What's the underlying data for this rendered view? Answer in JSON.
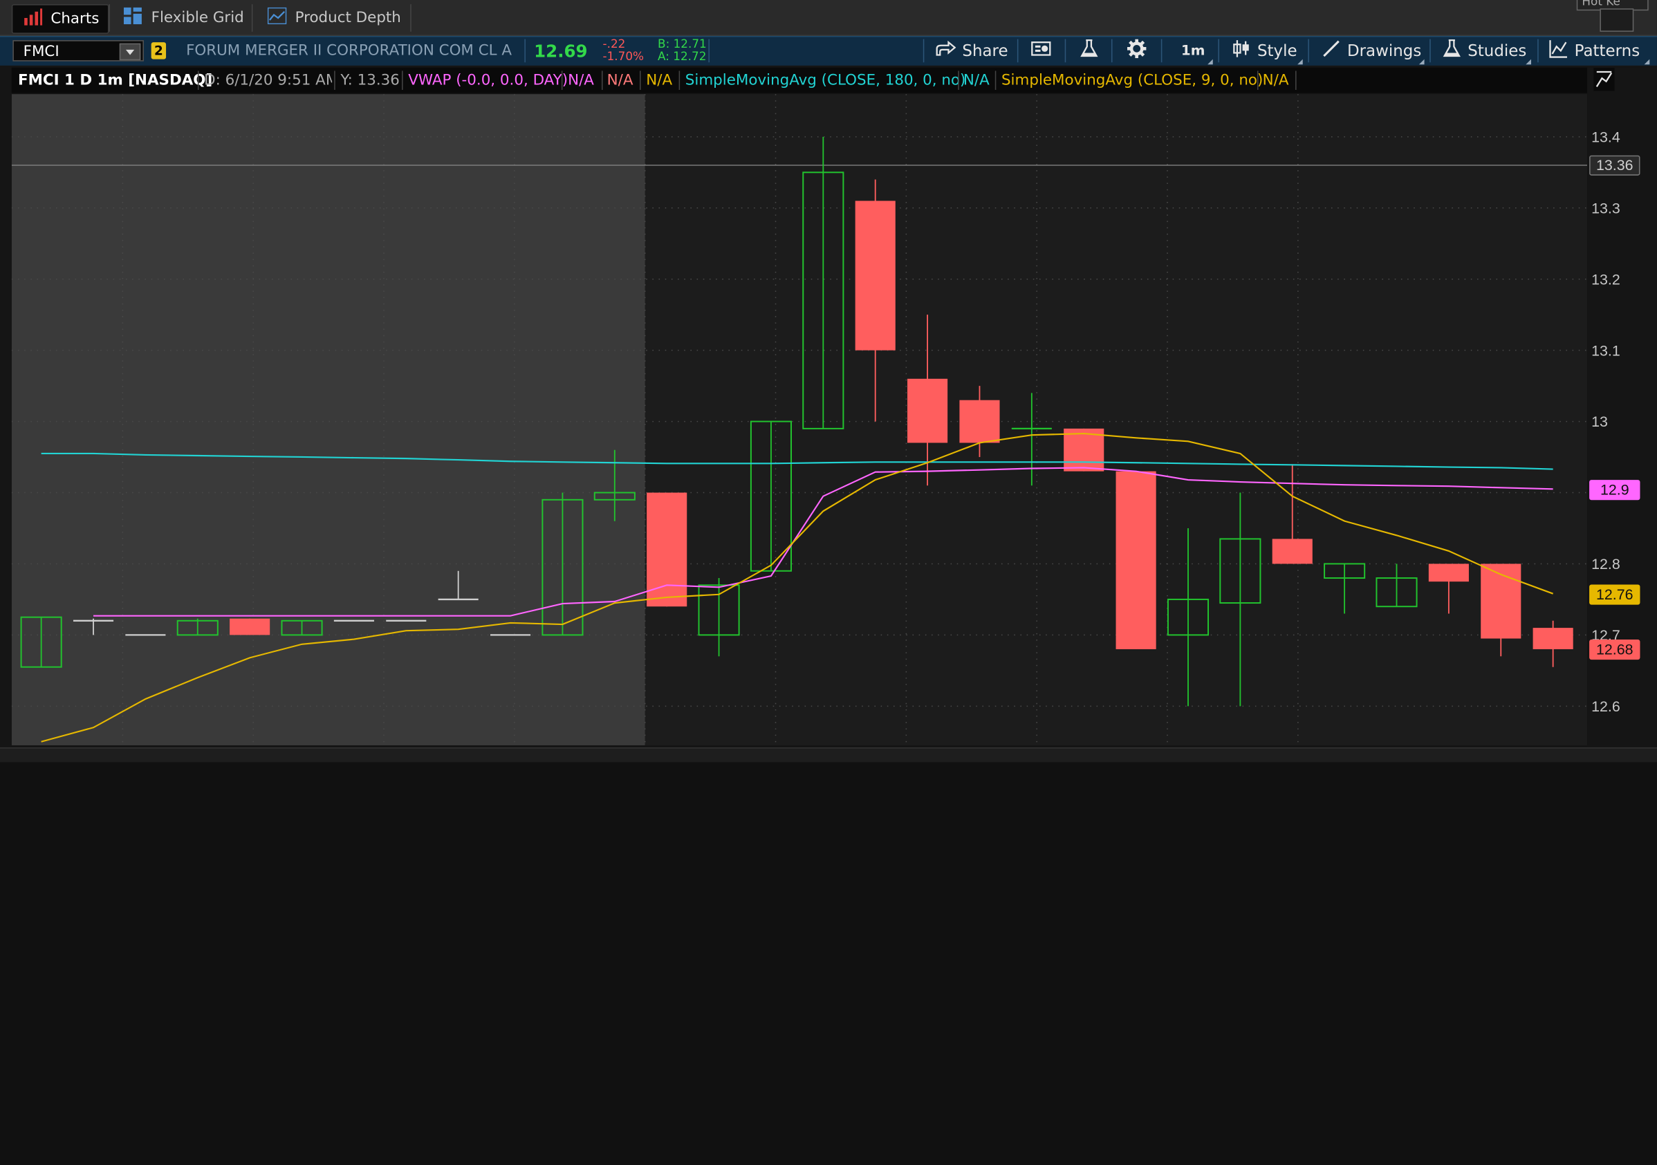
{
  "tabs": [
    {
      "label": "Charts",
      "active": true
    },
    {
      "label": "Flexible Grid",
      "active": false
    },
    {
      "label": "Product Depth",
      "active": false
    }
  ],
  "hotkeys_label": "Hot Ke",
  "toolbar": {
    "symbol": "FMCI",
    "link_badge": "2",
    "company": "FORUM MERGER II CORPORATION COM CL A",
    "last": "12.69",
    "change": "-.22",
    "change_pct": "-1.70%",
    "bid": "B: 12.71",
    "ask": "A: 12.72",
    "share": "Share",
    "timeframe": "1m",
    "style": "Style",
    "drawings": "Drawings",
    "studies": "Studies",
    "patterns": "Patterns"
  },
  "study_bar": {
    "title": "FMCI 1 D 1m [NASDAQ]",
    "date": "D: 6/1/20 9:51 AM",
    "y": "Y: 13.36",
    "vwap": "VWAP (-0.0, 0.0, DAY)",
    "vwap_vals": [
      "N/A",
      "N/A",
      "N/A"
    ],
    "sma180": "SimpleMovingAvg (CLOSE, 180, 0, no)",
    "sma180_val": "N/A",
    "sma9": "SimpleMovingAvg (CLOSE, 9, 0, no)",
    "sma9_val": "N/A"
  },
  "colors": {
    "up": "#22c32e",
    "down": "#ff5e5e",
    "vwap": "#ff66ff",
    "sma180": "#22d3d3",
    "sma9": "#e6b800",
    "premarket_bg": "#3a3a3a"
  },
  "chart_data": {
    "type": "candlestick",
    "ylim": [
      12.545,
      13.46
    ],
    "yticks": [
      "13.4",
      "13.3",
      "13.2",
      "13.1",
      "13",
      "12.9",
      "12.8",
      "12.7",
      "12.6"
    ],
    "crosshair_y": 13.36,
    "premarket_count": 12,
    "candles": [
      {
        "o": 12.655,
        "h": 12.725,
        "l": 12.655,
        "c": 12.725
      },
      {
        "o": 12.72,
        "h": 12.723,
        "l": 12.7,
        "c": 12.72
      },
      {
        "o": 12.7,
        "h": 12.7,
        "l": 12.7,
        "c": 12.7
      },
      {
        "o": 12.7,
        "h": 12.723,
        "l": 12.7,
        "c": 12.72
      },
      {
        "o": 12.723,
        "h": 12.723,
        "l": 12.7,
        "c": 12.7
      },
      {
        "o": 12.7,
        "h": 12.72,
        "l": 12.7,
        "c": 12.72
      },
      {
        "o": 12.72,
        "h": 12.72,
        "l": 12.72,
        "c": 12.72
      },
      {
        "o": 12.72,
        "h": 12.72,
        "l": 12.72,
        "c": 12.72
      },
      {
        "o": 12.75,
        "h": 12.79,
        "l": 12.75,
        "c": 12.75
      },
      {
        "o": 12.7,
        "h": 12.7,
        "l": 12.7,
        "c": 12.7
      },
      {
        "o": 12.7,
        "h": 12.9,
        "l": 12.7,
        "c": 12.89
      },
      {
        "o": 12.89,
        "h": 12.96,
        "l": 12.86,
        "c": 12.9
      },
      {
        "o": 12.9,
        "h": 12.9,
        "l": 12.74,
        "c": 12.74
      },
      {
        "o": 12.7,
        "h": 12.78,
        "l": 12.67,
        "c": 12.77
      },
      {
        "o": 12.79,
        "h": 13.0,
        "l": 12.79,
        "c": 13.0
      },
      {
        "o": 12.99,
        "h": 13.4,
        "l": 12.99,
        "c": 13.35
      },
      {
        "o": 13.31,
        "h": 13.34,
        "l": 13.0,
        "c": 13.1
      },
      {
        "o": 13.06,
        "h": 13.15,
        "l": 12.91,
        "c": 12.97
      },
      {
        "o": 13.03,
        "h": 13.05,
        "l": 12.95,
        "c": 12.97
      },
      {
        "o": 12.99,
        "h": 13.04,
        "l": 12.91,
        "c": 12.99
      },
      {
        "o": 12.99,
        "h": 12.99,
        "l": 12.93,
        "c": 12.93
      },
      {
        "o": 12.93,
        "h": 12.93,
        "l": 12.68,
        "c": 12.68
      },
      {
        "o": 12.7,
        "h": 12.85,
        "l": 12.6,
        "c": 12.75
      },
      {
        "o": 12.745,
        "h": 12.9,
        "l": 12.6,
        "c": 12.835
      },
      {
        "o": 12.835,
        "h": 12.94,
        "l": 12.8,
        "c": 12.8
      },
      {
        "o": 12.78,
        "h": 12.8,
        "l": 12.73,
        "c": 12.8
      },
      {
        "o": 12.74,
        "h": 12.8,
        "l": 12.74,
        "c": 12.78
      },
      {
        "o": 12.8,
        "h": 12.8,
        "l": 12.73,
        "c": 12.775
      },
      {
        "o": 12.8,
        "h": 12.8,
        "l": 12.67,
        "c": 12.695
      },
      {
        "o": 12.71,
        "h": 12.72,
        "l": 12.655,
        "c": 12.68
      }
    ],
    "vwap": [
      null,
      12.727,
      12.727,
      12.727,
      12.727,
      12.727,
      12.727,
      12.727,
      12.727,
      12.727,
      12.744,
      12.747,
      12.77,
      12.767,
      12.783,
      12.895,
      12.929,
      12.93,
      12.932,
      12.934,
      12.935,
      12.93,
      12.918,
      12.915,
      12.913,
      12.911,
      12.91,
      12.909,
      12.907,
      12.905
    ],
    "sma180": [
      12.955,
      12.955,
      12.953,
      12.952,
      12.951,
      12.95,
      12.949,
      12.948,
      12.946,
      12.944,
      12.943,
      12.942,
      12.941,
      12.941,
      12.941,
      12.942,
      12.943,
      12.943,
      12.943,
      12.943,
      12.943,
      12.942,
      12.941,
      12.94,
      12.939,
      12.938,
      12.937,
      12.936,
      12.935,
      12.933
    ],
    "sma9": [
      12.55,
      12.57,
      12.61,
      12.64,
      12.668,
      12.687,
      12.694,
      12.706,
      12.708,
      12.717,
      12.715,
      12.745,
      12.753,
      12.757,
      12.798,
      12.874,
      12.918,
      12.942,
      12.97,
      12.981,
      12.983,
      12.977,
      12.972,
      12.955,
      12.895,
      12.86,
      12.84,
      12.818,
      12.785,
      12.758
    ],
    "price_labels": [
      {
        "value": "13.36",
        "price": 13.36,
        "bg": "#2a2a2a",
        "fg": "#d0d0d0",
        "border": "#777"
      },
      {
        "value": "12.9",
        "price": 12.905,
        "bg": "#ff66ff",
        "fg": "#111",
        "border": "#ff66ff"
      },
      {
        "value": "12.76",
        "price": 12.758,
        "bg": "#e6b800",
        "fg": "#111",
        "border": "#e6b800"
      },
      {
        "value": "12.68",
        "price": 12.68,
        "bg": "#ff5e5e",
        "fg": "#111",
        "border": "#ff5e5e"
      }
    ]
  }
}
